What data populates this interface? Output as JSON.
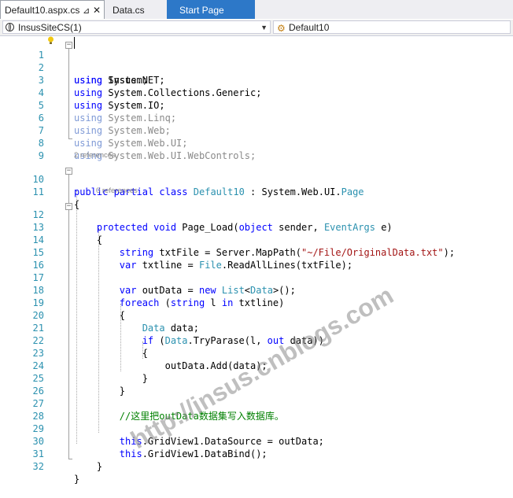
{
  "tabs": [
    {
      "label": "Default10.aspx.cs",
      "pin": "⊿",
      "close": "✕"
    },
    {
      "label": "Data.cs"
    },
    {
      "label": "Start Page"
    }
  ],
  "navbar": {
    "project_combo": "InsusSiteCS(1)",
    "class_combo": "Default10"
  },
  "references": {
    "class_refs": "2 references",
    "method_refs": "0 references"
  },
  "lines": [
    {
      "n": "1"
    },
    {
      "n": "2"
    },
    {
      "n": "3"
    },
    {
      "n": "4"
    },
    {
      "n": "5"
    },
    {
      "n": "6"
    },
    {
      "n": "7"
    },
    {
      "n": "8"
    },
    {
      "n": "9"
    },
    {
      "n": "10"
    },
    {
      "n": "11"
    },
    {
      "n": "12"
    },
    {
      "n": "13"
    },
    {
      "n": "14"
    },
    {
      "n": "15"
    },
    {
      "n": "16"
    },
    {
      "n": "17"
    },
    {
      "n": "18"
    },
    {
      "n": "19"
    },
    {
      "n": "20"
    },
    {
      "n": "21"
    },
    {
      "n": "22"
    },
    {
      "n": "23"
    },
    {
      "n": "24"
    },
    {
      "n": "25"
    },
    {
      "n": "26"
    },
    {
      "n": "27"
    },
    {
      "n": "28"
    },
    {
      "n": "29"
    },
    {
      "n": "30"
    },
    {
      "n": "31"
    },
    {
      "n": "32"
    }
  ],
  "code": {
    "l1": [
      "using",
      " Insus.NET;"
    ],
    "l2": [
      "using",
      " System;"
    ],
    "l3": [
      "using",
      " System.Collections.Generic;"
    ],
    "l4": [
      "using",
      " System.IO;"
    ],
    "l5": [
      "using",
      " System.Linq;"
    ],
    "l6": [
      "using",
      " System.Web;"
    ],
    "l7": [
      "using",
      " System.Web.UI;"
    ],
    "l8": [
      "using",
      " System.Web.UI.WebControls;"
    ],
    "l10": [
      "public",
      " ",
      "partial",
      " ",
      "class",
      " ",
      "Default10",
      " : System.Web.UI.",
      "Page"
    ],
    "l11": [
      "{"
    ],
    "l12": [
      "    ",
      "protected",
      " ",
      "void",
      " Page_Load(",
      "object",
      " sender, ",
      "EventArgs",
      " e)"
    ],
    "l13": [
      "    {"
    ],
    "l14": [
      "        ",
      "string",
      " txtFile = Server.MapPath(",
      "\"~/File/OriginalData.txt\"",
      ");"
    ],
    "l15": [
      "        ",
      "var",
      " txtline = ",
      "File",
      ".ReadAllLines(txtFile);"
    ],
    "l17": [
      "        ",
      "var",
      " outData = ",
      "new",
      " ",
      "List",
      "<",
      "Data",
      ">();"
    ],
    "l18": [
      "        ",
      "foreach",
      " (",
      "string",
      " l ",
      "in",
      " txtline)"
    ],
    "l19": [
      "        {"
    ],
    "l20": [
      "            ",
      "Data",
      " data;"
    ],
    "l21": [
      "            ",
      "if",
      " (",
      "Data",
      ".TryParase(l, ",
      "out",
      " data))"
    ],
    "l22": [
      "            {"
    ],
    "l23": [
      "                outData.Add(data);"
    ],
    "l24": [
      "            }"
    ],
    "l25": [
      "        }"
    ],
    "l27": [
      "        ",
      "//这里把outData数据集写入数据库。"
    ],
    "l29": [
      "        ",
      "this",
      ".GridView1.DataSource = outData;"
    ],
    "l30": [
      "        ",
      "this",
      ".GridView1.DataBind();"
    ],
    "l31": [
      "    }"
    ],
    "l32": [
      "}"
    ]
  },
  "watermark": "http://insus.cnblogs.com"
}
